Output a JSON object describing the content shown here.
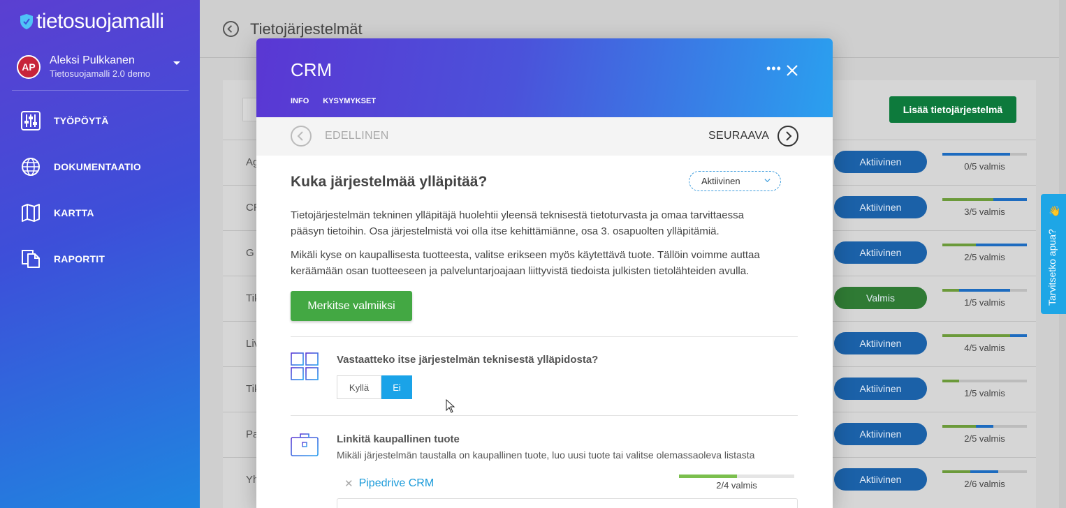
{
  "app": {
    "brand": "tietosuojamalli"
  },
  "user": {
    "initials": "AP",
    "name": "Aleksi Pulkkanen",
    "org": "Tietosuojamalli 2.0 demo"
  },
  "nav": [
    {
      "label": "TYÖPÖYTÄ",
      "icon": "sliders-icon"
    },
    {
      "label": "DOKUMENTAATIO",
      "icon": "globe-icon"
    },
    {
      "label": "KARTTA",
      "icon": "map-icon"
    },
    {
      "label": "RAPORTIT",
      "icon": "documents-icon"
    }
  ],
  "page": {
    "title": "Tietojärjestelmät",
    "add_button": "Lisää tietojärjestelmä"
  },
  "rows": [
    {
      "name": "Ag",
      "status": "Aktiivinen",
      "green": 0,
      "blue": 0.8,
      "progress": "0/5 valmis"
    },
    {
      "name": "CR",
      "status": "Aktiivinen",
      "green": 0.6,
      "blue": 0.4,
      "progress": "3/5 valmis"
    },
    {
      "name": "G",
      "status": "Aktiivinen",
      "green": 0.4,
      "blue": 0.6,
      "progress": "2/5 valmis"
    },
    {
      "name": "Tik",
      "status": "Valmis",
      "green": 0.2,
      "blue": 0.6,
      "progress": "1/5 valmis"
    },
    {
      "name": "Liv",
      "status": "Aktiivinen",
      "green": 0.8,
      "blue": 0.2,
      "progress": "4/5 valmis"
    },
    {
      "name": "Tik",
      "status": "Aktiivinen",
      "green": 0.2,
      "blue": 0,
      "progress": "1/5 valmis"
    },
    {
      "name": "Pa",
      "status": "Aktiivinen",
      "green": 0.4,
      "blue": 0.2,
      "progress": "2/5 valmis"
    },
    {
      "name": "Yh",
      "status": "Aktiivinen",
      "green": 0.33,
      "blue": 0.33,
      "progress": "2/6 valmis"
    }
  ],
  "help": {
    "label": "Tarvitsetko apua?",
    "emoji": "👋"
  },
  "modal": {
    "title": "CRM",
    "more": "•••",
    "tabs": [
      "INFO",
      "KYSYMYKSET"
    ],
    "prev": "EDELLINEN",
    "next": "SEURAAVA",
    "question": "Kuka järjestelmää ylläpitää?",
    "status_value": "Aktiivinen",
    "paragraph1": "Tietojärjestelmän tekninen ylläpitäjä huolehtii yleensä teknisestä tietoturvasta ja omaa tarvittaessa pääsyn tietoihin. Osa järjestelmistä voi olla itse kehittämiänne, osa 3. osapuolten ylläpitämiä.",
    "paragraph2": "Mikäli kyse on kaupallisesta tuotteesta, valitse erikseen myös käytettävä tuote. Tällöin voimme auttaa keräämään osan tuotteeseen ja palveluntarjoajaan liittyvistä tiedoista julkisten tietolähteiden avulla.",
    "done_button": "Merkitse valmiiksi",
    "sub1": {
      "title": "Vastaatteko itse järjestelmän teknisestä ylläpidosta?",
      "yes": "Kyllä",
      "no": "Ei",
      "selected": "Ei"
    },
    "sub2": {
      "title": "Linkitä kaupallinen tuote",
      "desc": "Mikäli järjestelmän taustalla on kaupallinen tuote, luo uusi tuote tai valitse olemassaoleva listasta",
      "product": "Pipedrive CRM",
      "progress_text": "2/4 valmis",
      "progress": 0.5
    }
  },
  "colors": {
    "accent": "#1aa3e8",
    "success": "#43a843",
    "brand_green": "#0d7a3c"
  }
}
